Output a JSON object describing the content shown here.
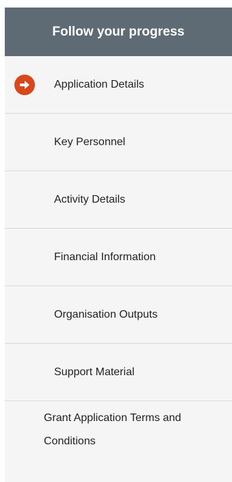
{
  "progress": {
    "title": "Follow your progress",
    "current_step_icon": "arrow-right-circle-icon",
    "accent_color": "#d9481a",
    "header_color": "#5f6b74",
    "steps": [
      {
        "label": "Application Details",
        "current": true
      },
      {
        "label": "Key Personnel",
        "current": false
      },
      {
        "label": "Activity Details",
        "current": false
      },
      {
        "label": "Financial Information",
        "current": false
      },
      {
        "label": "Organisation Outputs",
        "current": false
      },
      {
        "label": "Support Material",
        "current": false
      },
      {
        "label": "Grant Application Terms and Conditions",
        "current": false
      }
    ]
  }
}
